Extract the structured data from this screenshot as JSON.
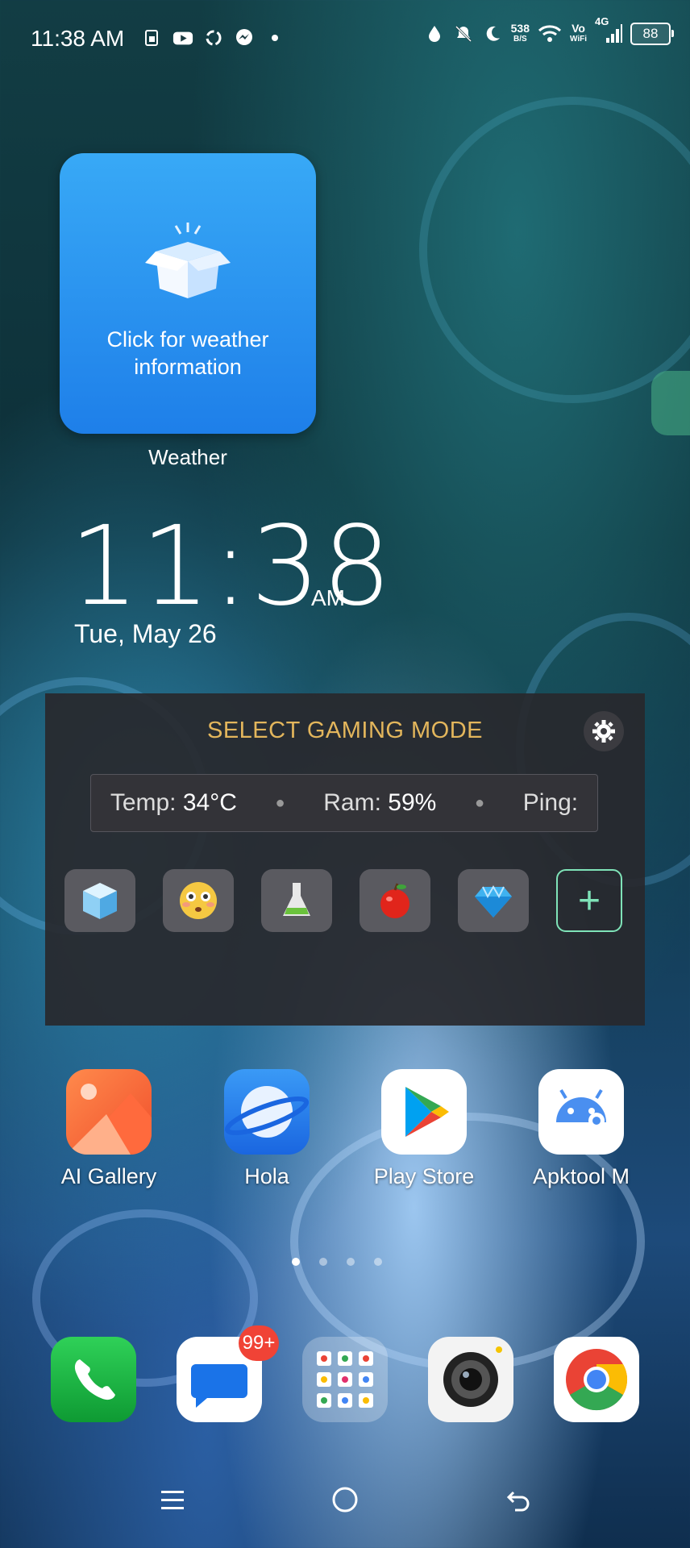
{
  "status_bar": {
    "time": "11:38 AM",
    "net_speed_value": "538",
    "net_speed_unit": "B/S",
    "volte_top": "Vo",
    "volte_bottom": "WiFi",
    "network": "4G",
    "battery": "88",
    "left_icons": [
      "sim-icon",
      "youtube-icon",
      "sync-icon",
      "messenger-icon",
      "more-dot-icon"
    ],
    "right_icons": [
      "drop-icon",
      "mute-icon",
      "moon-icon",
      "wifi-icon",
      "signal-icon"
    ]
  },
  "weather_widget": {
    "message": "Click for weather information",
    "label": "Weather",
    "color": "#2a8ff0"
  },
  "clock_widget": {
    "time": "11:38",
    "ampm": "AM",
    "date": "Tue, May 26"
  },
  "gaming_panel": {
    "title": "SELECT GAMING MODE",
    "temp_label": "Temp:",
    "temp_value": "34°C",
    "ram_label": "Ram:",
    "ram_value": "59%",
    "ping_label": "Ping:",
    "modes": [
      "ice-cube-icon",
      "flushed-face-icon",
      "flask-icon",
      "apple-icon",
      "diamond-icon"
    ],
    "title_color": "#e3b65c",
    "add_color": "#7fe3b8"
  },
  "apps": [
    {
      "label": "AI Gallery",
      "icon": "gallery-icon"
    },
    {
      "label": "Hola",
      "icon": "browser-icon"
    },
    {
      "label": "Play Store",
      "icon": "play-store-icon"
    },
    {
      "label": "Apktool M",
      "icon": "android-icon"
    }
  ],
  "dock": {
    "messages_badge": "99+",
    "items": [
      "phone-icon",
      "messages-icon",
      "google-folder-icon",
      "camera-icon",
      "chrome-icon"
    ]
  },
  "pager": {
    "pages": 4,
    "current": 1
  }
}
